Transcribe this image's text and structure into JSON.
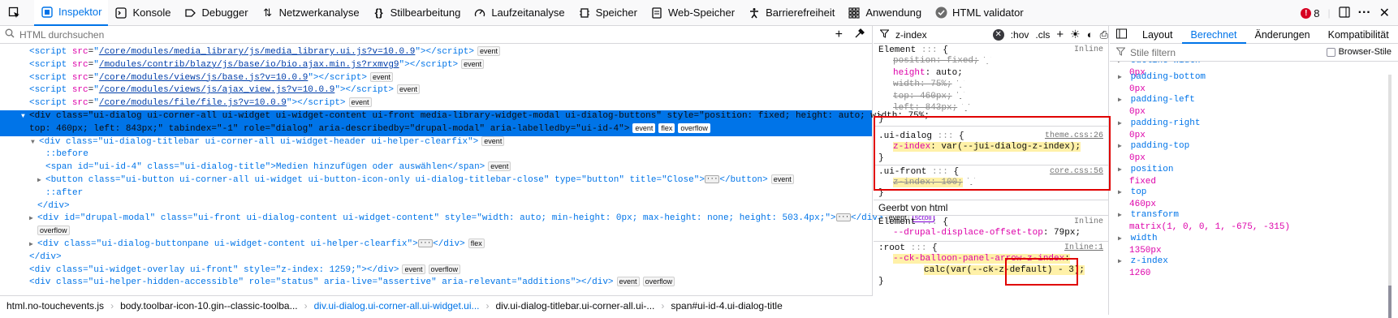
{
  "toolbar": {
    "tabs": [
      {
        "label": "Inspektor",
        "icon": "inspector-icon"
      },
      {
        "label": "Konsole",
        "icon": "console-icon"
      },
      {
        "label": "Debugger",
        "icon": "debugger-icon"
      },
      {
        "label": "Netzwerkanalyse",
        "icon": "network-icon"
      },
      {
        "label": "Stilbearbeitung",
        "icon": "style-editor-icon"
      },
      {
        "label": "Laufzeitanalyse",
        "icon": "performance-icon"
      },
      {
        "label": "Speicher",
        "icon": "memory-icon"
      },
      {
        "label": "Web-Speicher",
        "icon": "storage-icon"
      },
      {
        "label": "Barrierefreiheit",
        "icon": "accessibility-icon"
      },
      {
        "label": "Anwendung",
        "icon": "application-icon"
      },
      {
        "label": "HTML validator",
        "icon": "validator-icon"
      }
    ],
    "error_count": "8"
  },
  "markup": {
    "search_placeholder": "HTML durchsuchen",
    "scripts": [
      {
        "src": "/core/modules/media_library/js/media_library.ui.js?v=10.0.9"
      },
      {
        "src": "/modules/contrib/blazy/js/base/io/bio.ajax.min.js?rxmvg9"
      },
      {
        "src": "/core/modules/views/js/base.js?v=10.0.9"
      },
      {
        "src": "/core/modules/views/js/ajax_view.js?v=10.0.9"
      },
      {
        "src": "/core/modules/file/file.js?v=10.0.9"
      }
    ],
    "selected_line1": "<div class=\"ui-dialog ui-corner-all ui-widget ui-widget-content ui-front media-library-widget-modal ui-dialog-buttons\" style=\"position: fixed; height: auto; width: 75%;",
    "selected_line2": "top: 460px; left: 843px;\" tabindex=\"-1\" role=\"dialog\" aria-describedby=\"drupal-modal\" aria-labelledby=\"ui-id-4\">",
    "titlebar": "<div class=\"ui-dialog-titlebar ui-corner-all ui-widget-header ui-helper-clearfix\">",
    "before": "::before",
    "span_line": "<span id=\"ui-id-4\" class=\"ui-dialog-title\">Medien hinzufügen oder auswählen</span>",
    "button_line": "<button class=\"ui-button ui-corner-all ui-widget ui-button-icon-only ui-dialog-titlebar-close\" type=\"button\" title=\"Close\">",
    "button_close": "</button>",
    "after": "::after",
    "div_close": "</div>",
    "modal_line": "<div id=\"drupal-modal\" class=\"ui-front ui-dialog-content ui-widget-content\" style=\"width: auto; min-height: 0px; max-height: none; height: 503.4px;\">",
    "buttonpane_line": "<div class=\"ui-dialog-buttonpane ui-widget-content ui-helper-clearfix\">",
    "overlay_line": "<div class=\"ui-widget-overlay ui-front\" style=\"z-index: 1259;\"></div>",
    "hidden_line": "<div class=\"ui-helper-hidden-accessible\" role=\"status\" aria-live=\"assertive\" aria-relevant=\"additions\"></div>",
    "badges": {
      "event": "event",
      "flex": "flex",
      "overflow": "overflow",
      "scroll": "scroll"
    }
  },
  "breadcrumbs": [
    "html.no-touchevents.js",
    "body.toolbar-icon-10.gin--classic-toolba...",
    "div.ui-dialog.ui-corner-all.ui-widget.ui...",
    "div.ui-dialog-titlebar.ui-corner-all.ui-...",
    "span#ui-id-4.ui-dialog-title"
  ],
  "rules": {
    "filter_value": "z-index",
    "hov": ":hov",
    "cls": ".cls",
    "element_rule": {
      "selector": "Element",
      "source": "Inline",
      "decls": [
        {
          "name": "position",
          "value": "fixed;"
        },
        {
          "name": "height",
          "value": "auto;"
        },
        {
          "name": "width",
          "value": "75%;"
        },
        {
          "name": "top",
          "value": "460px;"
        },
        {
          "name": "left",
          "value": "843px;"
        }
      ]
    },
    "ui_dialog": {
      "selector": ".ui-dialog",
      "source": "theme.css:26",
      "decl_name": "z-index",
      "decl_value": "var(--jui-dialog-z-index);"
    },
    "ui_front": {
      "selector": ".ui-front",
      "source": "core.css:56",
      "decl_name": "z-index",
      "decl_value": "100;"
    },
    "inherited_header": "Geerbt von html",
    "inh_element": {
      "selector": "Element",
      "source": "Inline",
      "decl_name": "--drupal-displace-offset-top",
      "decl_value": "79px;"
    },
    "root_rule": {
      "selector": ":root",
      "source": "Inline:1",
      "decl_name": "--ck-balloon-panel-arrow-z-index",
      "decl_value": "calc(var(--ck-z-default) - 3);"
    },
    "brace_open": "{",
    "brace_close": "}"
  },
  "computed": {
    "tabs": [
      "Layout",
      "Berechnet",
      "Änderungen",
      "Kompatibilität"
    ],
    "filter_placeholder": "Stile filtern",
    "browser_styles": "Browser-Stile",
    "props": [
      {
        "name": "outline-width",
        "value": "0px"
      },
      {
        "name": "padding-bottom",
        "value": "0px"
      },
      {
        "name": "padding-left",
        "value": "0px"
      },
      {
        "name": "padding-right",
        "value": "0px"
      },
      {
        "name": "padding-top",
        "value": "0px"
      },
      {
        "name": "position",
        "value": "fixed"
      },
      {
        "name": "top",
        "value": "460px"
      },
      {
        "name": "transform",
        "value": "matrix(1, 0, 0, 1, -675, -315)"
      },
      {
        "name": "width",
        "value": "1350px"
      },
      {
        "name": "z-index",
        "value": "1260"
      }
    ]
  }
}
